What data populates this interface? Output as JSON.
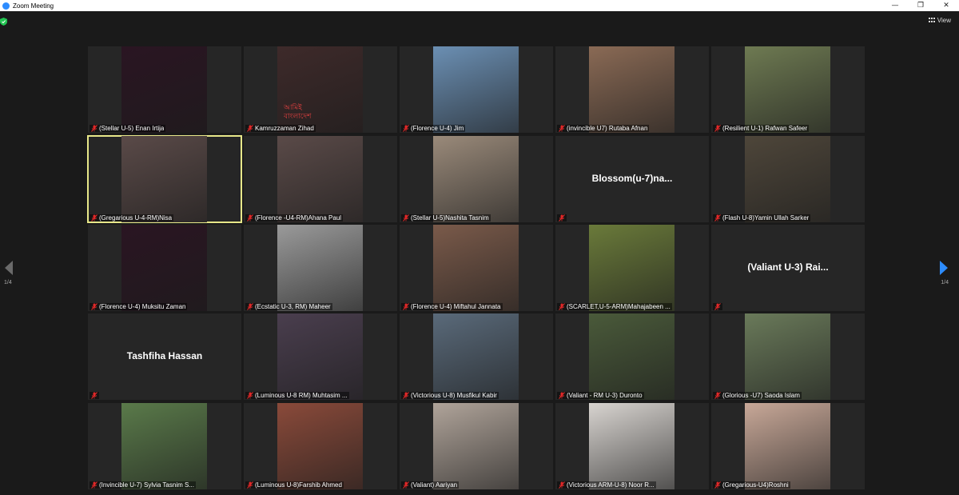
{
  "window": {
    "title": "Zoom Meeting",
    "controls": [
      "—",
      "❐",
      "✕"
    ]
  },
  "toolbar": {
    "view_label": "View"
  },
  "pager": {
    "left_label": "1/4",
    "right_label": "1/4"
  },
  "colors": {
    "background": "#1a1a1a",
    "tile": "#262626",
    "active_border": "#e7e789",
    "mic_muted": "#e02828"
  },
  "participants": [
    {
      "name": "(Stellar U-5) Enan Irtija",
      "video": true,
      "photo_color": "#2a1522"
    },
    {
      "name": "Kamruzzaman Zihad",
      "video": true,
      "photo_color": "#3e2a2a",
      "overlay_text": [
        "আমিই",
        "বাংলাদেশ"
      ]
    },
    {
      "name": "(Florence U-4) Jim",
      "video": true,
      "photo_color": "#6b8fb3"
    },
    {
      "name": "(invincible U7) Rutaba Afnan",
      "video": true,
      "photo_color": "#8a6a55"
    },
    {
      "name": "(Resilient U-1) Rafwan Safeer",
      "video": true,
      "photo_color": "#6e7a52"
    },
    {
      "name": "(Gregarious U-4-RM)Nisa",
      "video": true,
      "photo_color": "#5a4a48",
      "active": true
    },
    {
      "name": "(Florence -U4-RM)Ahana Paul",
      "video": true,
      "photo_color": "#5a4a48"
    },
    {
      "name": "(Stellar U-5)Nashita Tasnim",
      "video": true,
      "photo_color": "#9a8a7a"
    },
    {
      "name": "Blossom(u-7)na...",
      "video": false
    },
    {
      "name": "(Flash U-8)Yamin Ullah Sarker",
      "video": true,
      "photo_color": "#4e463a"
    },
    {
      "name": "(Florence U-4) Muksitu Zaman",
      "video": true,
      "photo_color": "#2a1522"
    },
    {
      "name": "(Ecstatic U-3, RM) Maheer",
      "video": true,
      "photo_color": "#9a9a9a"
    },
    {
      "name": "(Florence U-4) Miftahul Jannata",
      "video": true,
      "photo_color": "#7a5a4a"
    },
    {
      "name": "(SCARLET,U-5-ARM)Mahajabeen ...",
      "video": true,
      "photo_color": "#6a7a3a"
    },
    {
      "name": "(Valiant U-3) Rai...",
      "video": false
    },
    {
      "name": "Tashfiha Hassan",
      "video": false
    },
    {
      "name": "(Luminous U-8 RM) Muhtasim ...",
      "video": true,
      "photo_color": "#4a3e4e"
    },
    {
      "name": "(Victorious U-8) Musfikul Kabir",
      "video": true,
      "photo_color": "#5a6a7a"
    },
    {
      "name": "(Valiant - RM U-3) Duronto",
      "video": true,
      "photo_color": "#4a5a3a"
    },
    {
      "name": "(Glorious -U7) Saoda Islam",
      "video": true,
      "photo_color": "#6a7a5a"
    },
    {
      "name": "(Invincible U-7) Sylvia Tasnim S...",
      "video": true,
      "photo_color": "#5a7a4a"
    },
    {
      "name": "(Luminous U-8)Farshib Ahmed",
      "video": true,
      "photo_color": "#8a4a3a"
    },
    {
      "name": "(Valiant) Aariyan",
      "video": true,
      "photo_color": "#b0a49a"
    },
    {
      "name": "(Victorious ARM-U-8) Noor R...",
      "video": true,
      "photo_color": "#d8d4d0"
    },
    {
      "name": "(Gregarious-U4)Roshni",
      "video": true,
      "photo_color": "#c8a898"
    }
  ]
}
